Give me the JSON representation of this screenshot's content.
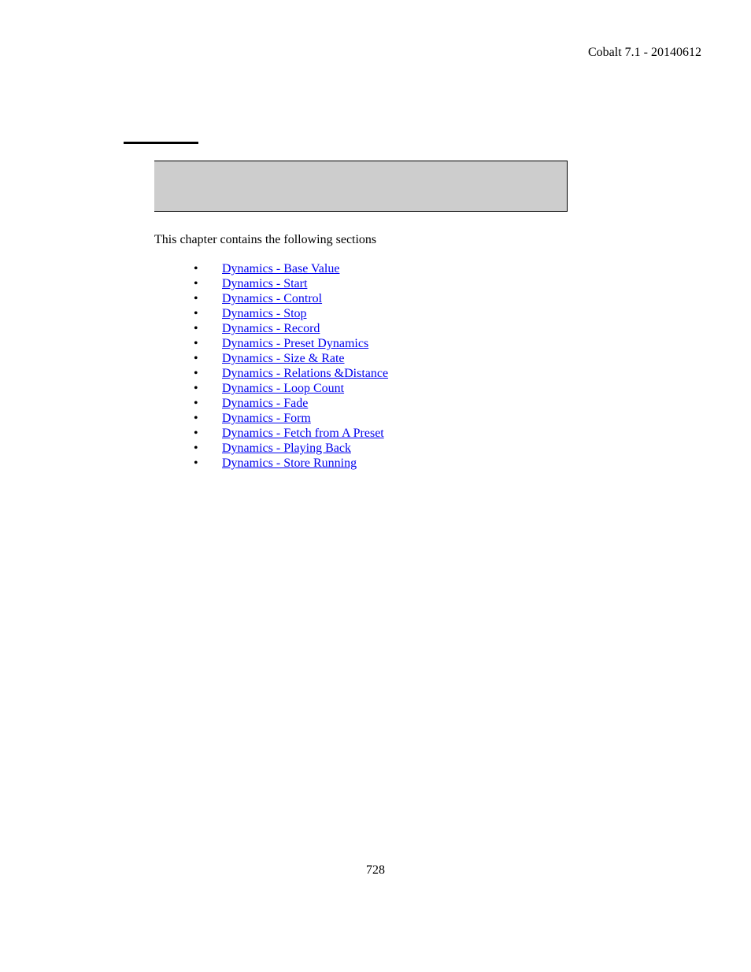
{
  "header": "Cobalt 7.1 - 20140612",
  "intro": "This chapter contains the following sections",
  "links": [
    "Dynamics - Base Value",
    "Dynamics - Start",
    "Dynamics - Control",
    "Dynamics - Stop",
    "Dynamics - Record",
    "Dynamics - Preset Dynamics",
    "Dynamics - Size & Rate",
    "Dynamics - Relations &Distance",
    "Dynamics - Loop Count",
    "Dynamics - Fade",
    "Dynamics - Form",
    "Dynamics - Fetch from A Preset",
    "Dynamics - Playing Back",
    "Dynamics - Store Running"
  ],
  "pageNumber": "728"
}
